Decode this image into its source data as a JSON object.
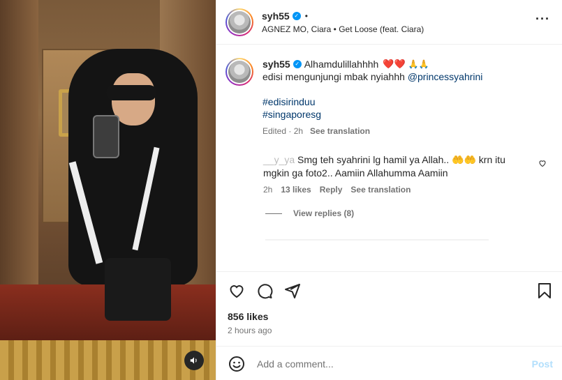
{
  "post": {
    "username": "syh55",
    "song": "AGNEZ MO, Ciara • Get Loose (feat. Ciara)",
    "more_icon": "more-horizontal-icon"
  },
  "caption": {
    "username": "syh55",
    "text_line1": "Alhamdulillahhhh",
    "hearts": "❤️❤️",
    "hands": "🙏🙏",
    "text_line2": "edisi mengunjungi mbak nyiahhh",
    "mention": "@princessyahrini",
    "hashtag1": "#edisirinduu",
    "hashtag2": "#singaporesg",
    "edited": "Edited · 2h",
    "see_translation": "See translation"
  },
  "comment": {
    "user_blurred": "__y_ya",
    "text": "Smg teh syahrini lg hamil ya Allah.. 🤲🤲 krn itu mgkin ga foto2.. Aamiin Allahumma Aamiin",
    "time": "2h",
    "likes": "13 likes",
    "reply": "Reply",
    "see_translation": "See translation",
    "view_replies": "View replies (8)"
  },
  "actions": {
    "likes": "856 likes",
    "time_ago": "2 hours ago"
  },
  "add_comment": {
    "placeholder": "Add a comment...",
    "post": "Post"
  },
  "colors": {
    "link": "#00376b",
    "verified": "#0095f6",
    "muted": "#737373",
    "post_disabled": "#b2dffc"
  }
}
